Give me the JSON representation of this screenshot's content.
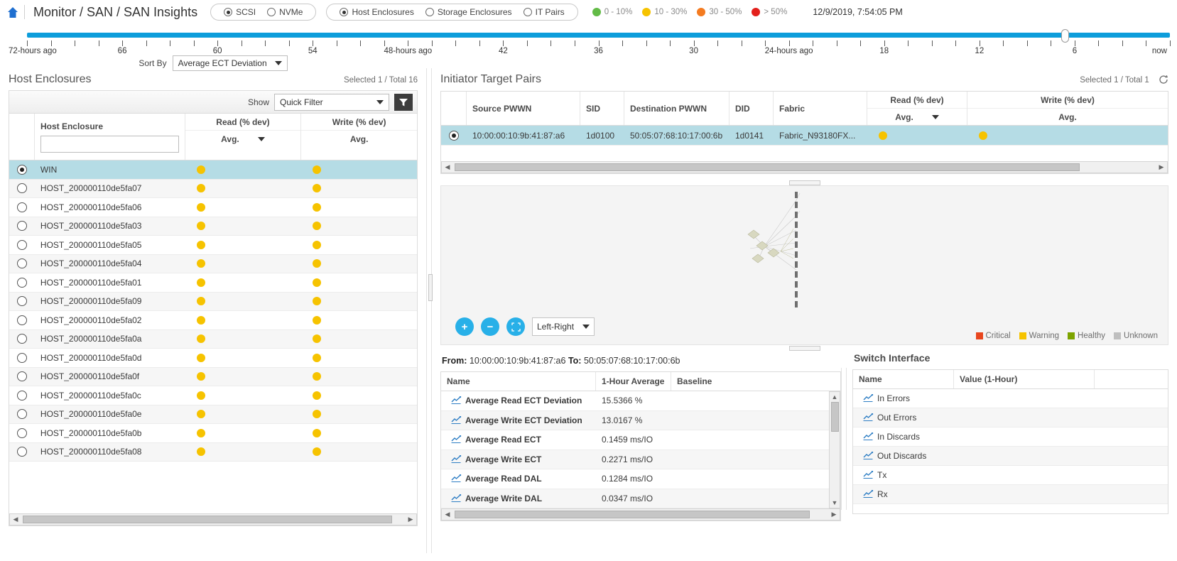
{
  "topbar": {
    "home_icon": "home-icon",
    "title": "Monitor / SAN / SAN Insights",
    "protocol_group": [
      {
        "label": "SCSI",
        "selected": true
      },
      {
        "label": "NVMe",
        "selected": false
      }
    ],
    "view_group": [
      {
        "label": "Host Enclosures",
        "selected": true
      },
      {
        "label": "Storage Enclosures",
        "selected": false
      },
      {
        "label": "IT Pairs",
        "selected": false
      }
    ],
    "severity_legend": [
      {
        "label": "0 - 10%",
        "color": "#63bb47"
      },
      {
        "label": "10 - 30%",
        "color": "#f6c300"
      },
      {
        "label": "30 - 50%",
        "color": "#f47b20"
      },
      {
        "label": "> 50%",
        "color": "#e3201c"
      }
    ],
    "timestamp": "12/9/2019, 7:54:05 PM"
  },
  "timeline": {
    "track_color": "#0d9ddb",
    "labels": [
      "72-hours ago",
      "66",
      "60",
      "54",
      "48-hours ago",
      "42",
      "36",
      "30",
      "24-hours ago",
      "18",
      "12",
      "6",
      "now"
    ],
    "tick_count": 49,
    "handle_position_label": "now"
  },
  "sort_by": {
    "label": "Sort By",
    "value": "Average ECT Deviation"
  },
  "host_enclosures": {
    "title": "Host Enclosures",
    "count": "Selected 1 / Total 16",
    "toolbar": {
      "show_label": "Show",
      "filter_value": "Quick Filter",
      "filter_icon": "funnel-icon"
    },
    "columns": {
      "name": "Host Enclosure",
      "read": {
        "top": "Read (% dev)",
        "bottom": "Avg."
      },
      "write": {
        "top": "Write (% dev)",
        "bottom": "Avg."
      }
    },
    "filter_input_value": "",
    "rows": [
      {
        "name": "WIN",
        "read": "#f6c300",
        "write": "#f6c300",
        "selected": true
      },
      {
        "name": "HOST_200000110de5fa07",
        "read": "#f6c300",
        "write": "#f6c300",
        "selected": false
      },
      {
        "name": "HOST_200000110de5fa06",
        "read": "#f6c300",
        "write": "#f6c300",
        "selected": false
      },
      {
        "name": "HOST_200000110de5fa03",
        "read": "#f6c300",
        "write": "#f6c300",
        "selected": false
      },
      {
        "name": "HOST_200000110de5fa05",
        "read": "#f6c300",
        "write": "#f6c300",
        "selected": false
      },
      {
        "name": "HOST_200000110de5fa04",
        "read": "#f6c300",
        "write": "#f6c300",
        "selected": false
      },
      {
        "name": "HOST_200000110de5fa01",
        "read": "#f6c300",
        "write": "#f6c300",
        "selected": false
      },
      {
        "name": "HOST_200000110de5fa09",
        "read": "#f6c300",
        "write": "#f6c300",
        "selected": false
      },
      {
        "name": "HOST_200000110de5fa02",
        "read": "#f6c300",
        "write": "#f6c300",
        "selected": false
      },
      {
        "name": "HOST_200000110de5fa0a",
        "read": "#f6c300",
        "write": "#f6c300",
        "selected": false
      },
      {
        "name": "HOST_200000110de5fa0d",
        "read": "#f6c300",
        "write": "#f6c300",
        "selected": false
      },
      {
        "name": "HOST_200000110de5fa0f",
        "read": "#f6c300",
        "write": "#f6c300",
        "selected": false
      },
      {
        "name": "HOST_200000110de5fa0c",
        "read": "#f6c300",
        "write": "#f6c300",
        "selected": false
      },
      {
        "name": "HOST_200000110de5fa0e",
        "read": "#f6c300",
        "write": "#f6c300",
        "selected": false
      },
      {
        "name": "HOST_200000110de5fa0b",
        "read": "#f6c300",
        "write": "#f6c300",
        "selected": false
      },
      {
        "name": "HOST_200000110de5fa08",
        "read": "#f6c300",
        "write": "#f6c300",
        "selected": false
      }
    ]
  },
  "itpairs": {
    "title": "Initiator Target Pairs",
    "count": "Selected 1 / Total 1",
    "refresh_icon": "refresh-icon",
    "columns": {
      "source_pwwn": "Source PWWN",
      "sid": "SID",
      "destination_pwwn": "Destination PWWN",
      "did": "DID",
      "fabric": "Fabric",
      "read": {
        "top": "Read (% dev)",
        "bottom": "Avg."
      },
      "write": {
        "top": "Write (% dev)",
        "bottom": "Avg."
      }
    },
    "rows": [
      {
        "source_pwwn": "10:00:00:10:9b:41:87:a6",
        "sid": "1d0100",
        "destination_pwwn": "50:05:07:68:10:17:00:6b",
        "did": "1d0141",
        "fabric": "Fabric_N93180FX...",
        "read": "#f6c300",
        "write": "#f6c300",
        "selected": true
      }
    ]
  },
  "topology": {
    "zoom_in_icon": "plus-icon",
    "zoom_out_icon": "minus-icon",
    "fit_icon": "expand-icon",
    "layout_value": "Left-Right",
    "legend": [
      {
        "label": "Critical",
        "color": "#e8461e"
      },
      {
        "label": "Warning",
        "color": "#f6c300"
      },
      {
        "label": "Healthy",
        "color": "#7da400"
      },
      {
        "label": "Unknown",
        "color": "#bfbfbf"
      }
    ]
  },
  "details": {
    "from_label": "From:",
    "from_value": "10:00:00:10:9b:41:87:a6",
    "to_label": "To:",
    "to_value": "50:05:07:68:10:17:00:6b",
    "columns": {
      "name": "Name",
      "avg": "1-Hour Average",
      "baseline": "Baseline"
    },
    "rows": [
      {
        "name": "Average Read ECT Deviation",
        "avg": "15.5366 %",
        "baseline": ""
      },
      {
        "name": "Average Write ECT Deviation",
        "avg": "13.0167 %",
        "baseline": ""
      },
      {
        "name": "Average Read ECT",
        "avg": "0.1459 ms/IO",
        "baseline": ""
      },
      {
        "name": "Average Write ECT",
        "avg": "0.2271 ms/IO",
        "baseline": ""
      },
      {
        "name": "Average Read DAL",
        "avg": "0.1284 ms/IO",
        "baseline": ""
      },
      {
        "name": "Average Write DAL",
        "avg": "0.0347 ms/IO",
        "baseline": ""
      }
    ]
  },
  "switch_interface": {
    "title": "Switch Interface",
    "columns": {
      "name": "Name",
      "value": "Value (1-Hour)"
    },
    "rows": [
      {
        "name": "In Errors",
        "value": ""
      },
      {
        "name": "Out Errors",
        "value": ""
      },
      {
        "name": "In Discards",
        "value": ""
      },
      {
        "name": "Out Discards",
        "value": ""
      },
      {
        "name": "Tx",
        "value": ""
      },
      {
        "name": "Rx",
        "value": ""
      }
    ]
  }
}
